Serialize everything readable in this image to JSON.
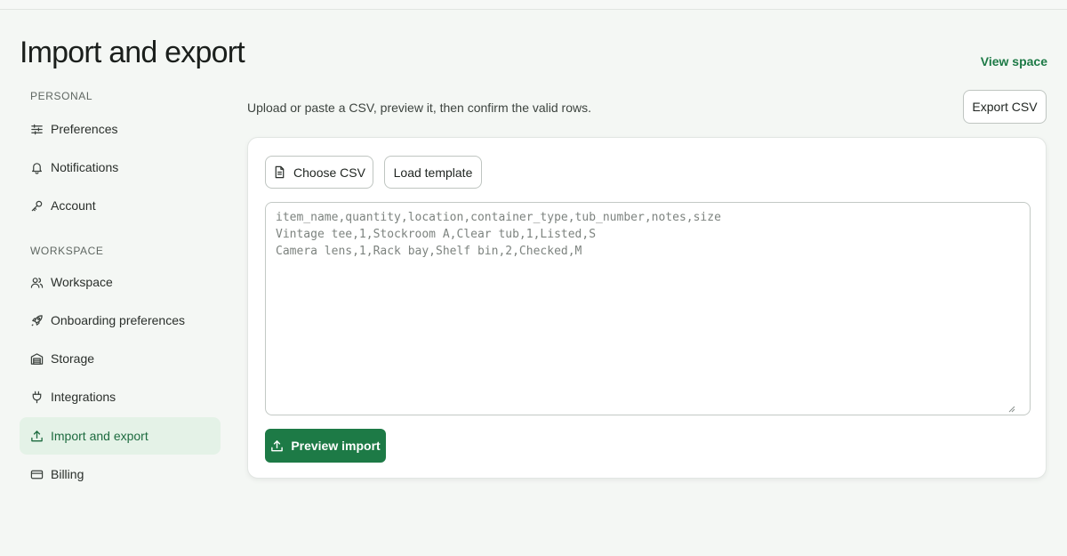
{
  "header": {
    "title": "Import and export",
    "view_space_label": "View space"
  },
  "sidebar": {
    "sections": [
      {
        "label": "PERSONAL",
        "items": [
          {
            "label": "Preferences",
            "icon": "sliders-icon"
          },
          {
            "label": "Notifications",
            "icon": "bell-icon"
          },
          {
            "label": "Account",
            "icon": "key-icon"
          }
        ]
      },
      {
        "label": "WORKSPACE",
        "items": [
          {
            "label": "Workspace",
            "icon": "users-icon"
          },
          {
            "label": "Onboarding preferences",
            "icon": "rocket-icon"
          },
          {
            "label": "Storage",
            "icon": "warehouse-icon"
          },
          {
            "label": "Integrations",
            "icon": "plug-icon"
          },
          {
            "label": "Import and export",
            "icon": "upload-icon",
            "active": true
          },
          {
            "label": "Billing",
            "icon": "credit-card-icon"
          }
        ]
      }
    ]
  },
  "main": {
    "subtitle": "Upload or paste a CSV, preview it, then confirm the valid rows.",
    "export_label": "Export CSV",
    "choose_csv_label": "Choose CSV",
    "load_template_label": "Load template",
    "csv_placeholder": "item_name,quantity,location,container_type,tub_number,notes,size\nVintage tee,1,Stockroom A,Clear tub,1,Listed,S\nCamera lens,1,Rack bay,Shelf bin,2,Checked,M",
    "preview_label": "Preview import"
  },
  "colors": {
    "accent": "#1d7a46",
    "active_bg": "#e4f2e7",
    "page_bg": "#f4f7f4"
  }
}
